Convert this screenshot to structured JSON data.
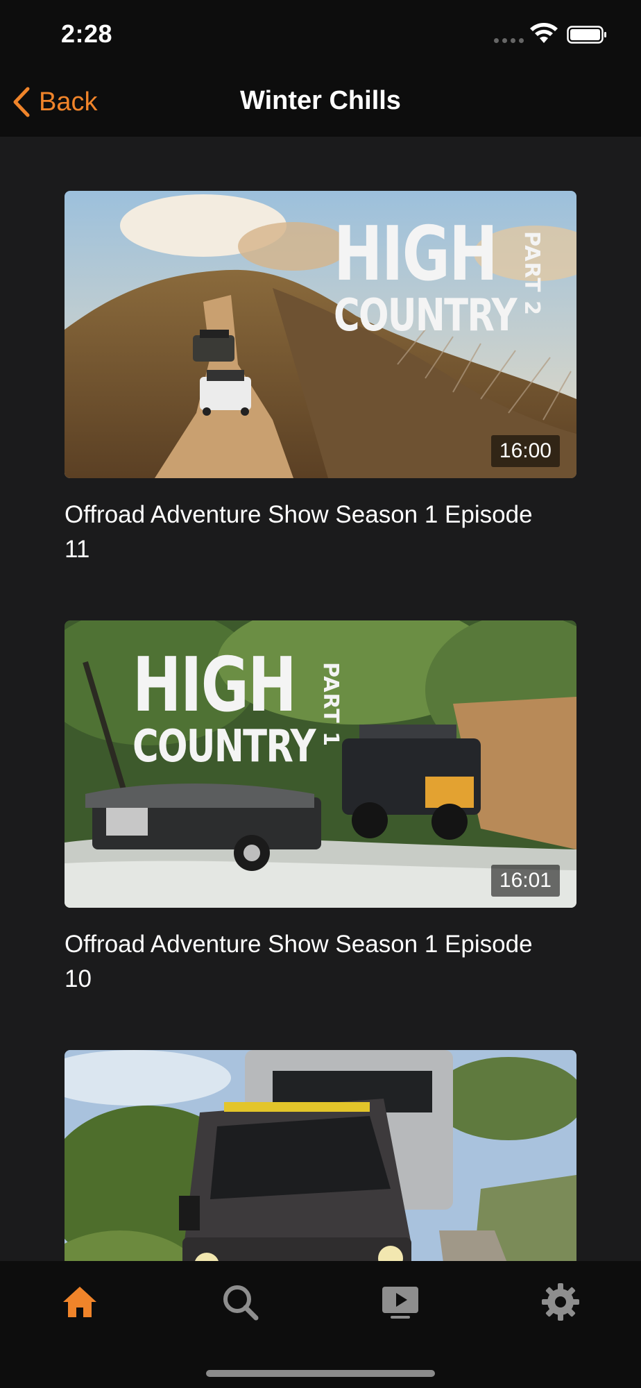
{
  "status_bar": {
    "time": "2:28"
  },
  "nav": {
    "back_label": "Back",
    "title": "Winter Chills"
  },
  "videos": [
    {
      "title": "Offroad Adventure Show Season 1 Episode 11",
      "duration": "16:00",
      "thumb_line1": "HIGH",
      "thumb_line2": "COUNTRY",
      "thumb_part": "PART 2"
    },
    {
      "title": "Offroad Adventure Show Season 1 Episode 10",
      "duration": "16:01",
      "thumb_line1": "HIGH",
      "thumb_line2": "COUNTRY",
      "thumb_part": "PART 1"
    },
    {
      "title": "",
      "duration": ""
    }
  ],
  "tabs": [
    {
      "name": "home",
      "icon": "home-icon",
      "active": true
    },
    {
      "name": "search",
      "icon": "search-icon",
      "active": false
    },
    {
      "name": "library",
      "icon": "video-library-icon",
      "active": false
    },
    {
      "name": "settings",
      "icon": "gear-icon",
      "active": false
    }
  ],
  "colors": {
    "accent": "#f0842a",
    "background": "#1b1b1c",
    "bars": "#0d0d0d",
    "inactive_icon": "#8e8e8e"
  }
}
